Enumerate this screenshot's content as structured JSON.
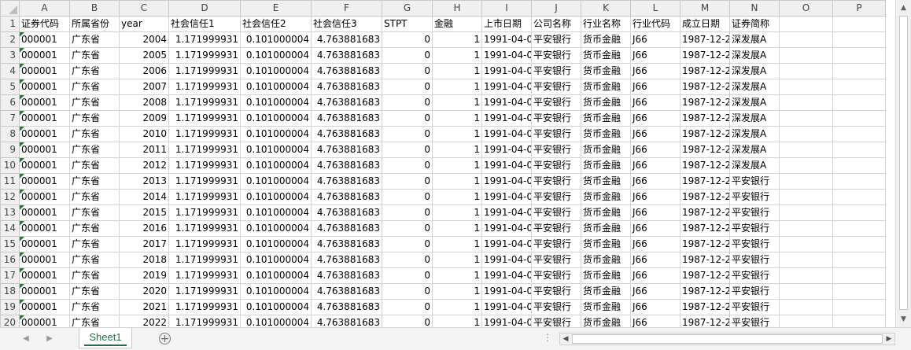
{
  "columns": [
    "A",
    "B",
    "C",
    "D",
    "E",
    "F",
    "G",
    "H",
    "I",
    "J",
    "K",
    "L",
    "M",
    "N",
    "O",
    "P"
  ],
  "rows": [
    [
      "1",
      "证券代码",
      "所属省份",
      "year",
      "社会信任1",
      "社会信任2",
      "社会信任3",
      "STPT",
      "金融",
      "上市日期",
      "公司名称",
      "行业名称",
      "行业代码",
      "成立日期",
      "证券简称",
      "",
      ""
    ],
    [
      "2",
      "000001",
      "广东省",
      "2004",
      "1.171999931",
      "0.101000004",
      "4.763881683",
      "0",
      "1",
      "1991-04-0",
      "平安银行",
      "货币金融",
      "J66",
      "1987-12-2",
      "深发展A",
      "",
      ""
    ],
    [
      "3",
      "000001",
      "广东省",
      "2005",
      "1.171999931",
      "0.101000004",
      "4.763881683",
      "0",
      "1",
      "1991-04-0",
      "平安银行",
      "货币金融",
      "J66",
      "1987-12-2",
      "深发展A",
      "",
      ""
    ],
    [
      "4",
      "000001",
      "广东省",
      "2006",
      "1.171999931",
      "0.101000004",
      "4.763881683",
      "0",
      "1",
      "1991-04-0",
      "平安银行",
      "货币金融",
      "J66",
      "1987-12-2",
      "深发展A",
      "",
      ""
    ],
    [
      "5",
      "000001",
      "广东省",
      "2007",
      "1.171999931",
      "0.101000004",
      "4.763881683",
      "0",
      "1",
      "1991-04-0",
      "平安银行",
      "货币金融",
      "J66",
      "1987-12-2",
      "深发展A",
      "",
      ""
    ],
    [
      "6",
      "000001",
      "广东省",
      "2008",
      "1.171999931",
      "0.101000004",
      "4.763881683",
      "0",
      "1",
      "1991-04-0",
      "平安银行",
      "货币金融",
      "J66",
      "1987-12-2",
      "深发展A",
      "",
      ""
    ],
    [
      "7",
      "000001",
      "广东省",
      "2009",
      "1.171999931",
      "0.101000004",
      "4.763881683",
      "0",
      "1",
      "1991-04-0",
      "平安银行",
      "货币金融",
      "J66",
      "1987-12-2",
      "深发展A",
      "",
      ""
    ],
    [
      "8",
      "000001",
      "广东省",
      "2010",
      "1.171999931",
      "0.101000004",
      "4.763881683",
      "0",
      "1",
      "1991-04-0",
      "平安银行",
      "货币金融",
      "J66",
      "1987-12-2",
      "深发展A",
      "",
      ""
    ],
    [
      "9",
      "000001",
      "广东省",
      "2011",
      "1.171999931",
      "0.101000004",
      "4.763881683",
      "0",
      "1",
      "1991-04-0",
      "平安银行",
      "货币金融",
      "J66",
      "1987-12-2",
      "深发展A",
      "",
      ""
    ],
    [
      "10",
      "000001",
      "广东省",
      "2012",
      "1.171999931",
      "0.101000004",
      "4.763881683",
      "0",
      "1",
      "1991-04-0",
      "平安银行",
      "货币金融",
      "J66",
      "1987-12-2",
      "深发展A",
      "",
      ""
    ],
    [
      "11",
      "000001",
      "广东省",
      "2013",
      "1.171999931",
      "0.101000004",
      "4.763881683",
      "0",
      "1",
      "1991-04-0",
      "平安银行",
      "货币金融",
      "J66",
      "1987-12-2",
      "平安银行",
      "",
      ""
    ],
    [
      "12",
      "000001",
      "广东省",
      "2014",
      "1.171999931",
      "0.101000004",
      "4.763881683",
      "0",
      "1",
      "1991-04-0",
      "平安银行",
      "货币金融",
      "J66",
      "1987-12-2",
      "平安银行",
      "",
      ""
    ],
    [
      "13",
      "000001",
      "广东省",
      "2015",
      "1.171999931",
      "0.101000004",
      "4.763881683",
      "0",
      "1",
      "1991-04-0",
      "平安银行",
      "货币金融",
      "J66",
      "1987-12-2",
      "平安银行",
      "",
      ""
    ],
    [
      "14",
      "000001",
      "广东省",
      "2016",
      "1.171999931",
      "0.101000004",
      "4.763881683",
      "0",
      "1",
      "1991-04-0",
      "平安银行",
      "货币金融",
      "J66",
      "1987-12-2",
      "平安银行",
      "",
      ""
    ],
    [
      "15",
      "000001",
      "广东省",
      "2017",
      "1.171999931",
      "0.101000004",
      "4.763881683",
      "0",
      "1",
      "1991-04-0",
      "平安银行",
      "货币金融",
      "J66",
      "1987-12-2",
      "平安银行",
      "",
      ""
    ],
    [
      "16",
      "000001",
      "广东省",
      "2018",
      "1.171999931",
      "0.101000004",
      "4.763881683",
      "0",
      "1",
      "1991-04-0",
      "平安银行",
      "货币金融",
      "J66",
      "1987-12-2",
      "平安银行",
      "",
      ""
    ],
    [
      "17",
      "000001",
      "广东省",
      "2019",
      "1.171999931",
      "0.101000004",
      "4.763881683",
      "0",
      "1",
      "1991-04-0",
      "平安银行",
      "货币金融",
      "J66",
      "1987-12-2",
      "平安银行",
      "",
      ""
    ],
    [
      "18",
      "000001",
      "广东省",
      "2020",
      "1.171999931",
      "0.101000004",
      "4.763881683",
      "0",
      "1",
      "1991-04-0",
      "平安银行",
      "货币金融",
      "J66",
      "1987-12-2",
      "平安银行",
      "",
      ""
    ],
    [
      "19",
      "000001",
      "广东省",
      "2021",
      "1.171999931",
      "0.101000004",
      "4.763881683",
      "0",
      "1",
      "1991-04-0",
      "平安银行",
      "货币金融",
      "J66",
      "1987-12-2",
      "平安银行",
      "",
      ""
    ],
    [
      "20",
      "000001",
      "广东省",
      "2022",
      "1.171999931",
      "0.101000004",
      "4.763881683",
      "0",
      "1",
      "1991-04-0",
      "平安银行",
      "货币金融",
      "J66",
      "1987-12-2",
      "平安银行",
      "",
      ""
    ]
  ],
  "sheet_tab": "Sheet1",
  "icons": {
    "add_sheet": "+",
    "nav_prev": "◀",
    "nav_next": "▶",
    "scroll_up": "▲",
    "scroll_down": "▼",
    "scroll_left": "◀",
    "scroll_right": "▶",
    "more": "⋮"
  },
  "colors": {
    "accent": "#217346",
    "error_marker": "#1e7d3c"
  }
}
